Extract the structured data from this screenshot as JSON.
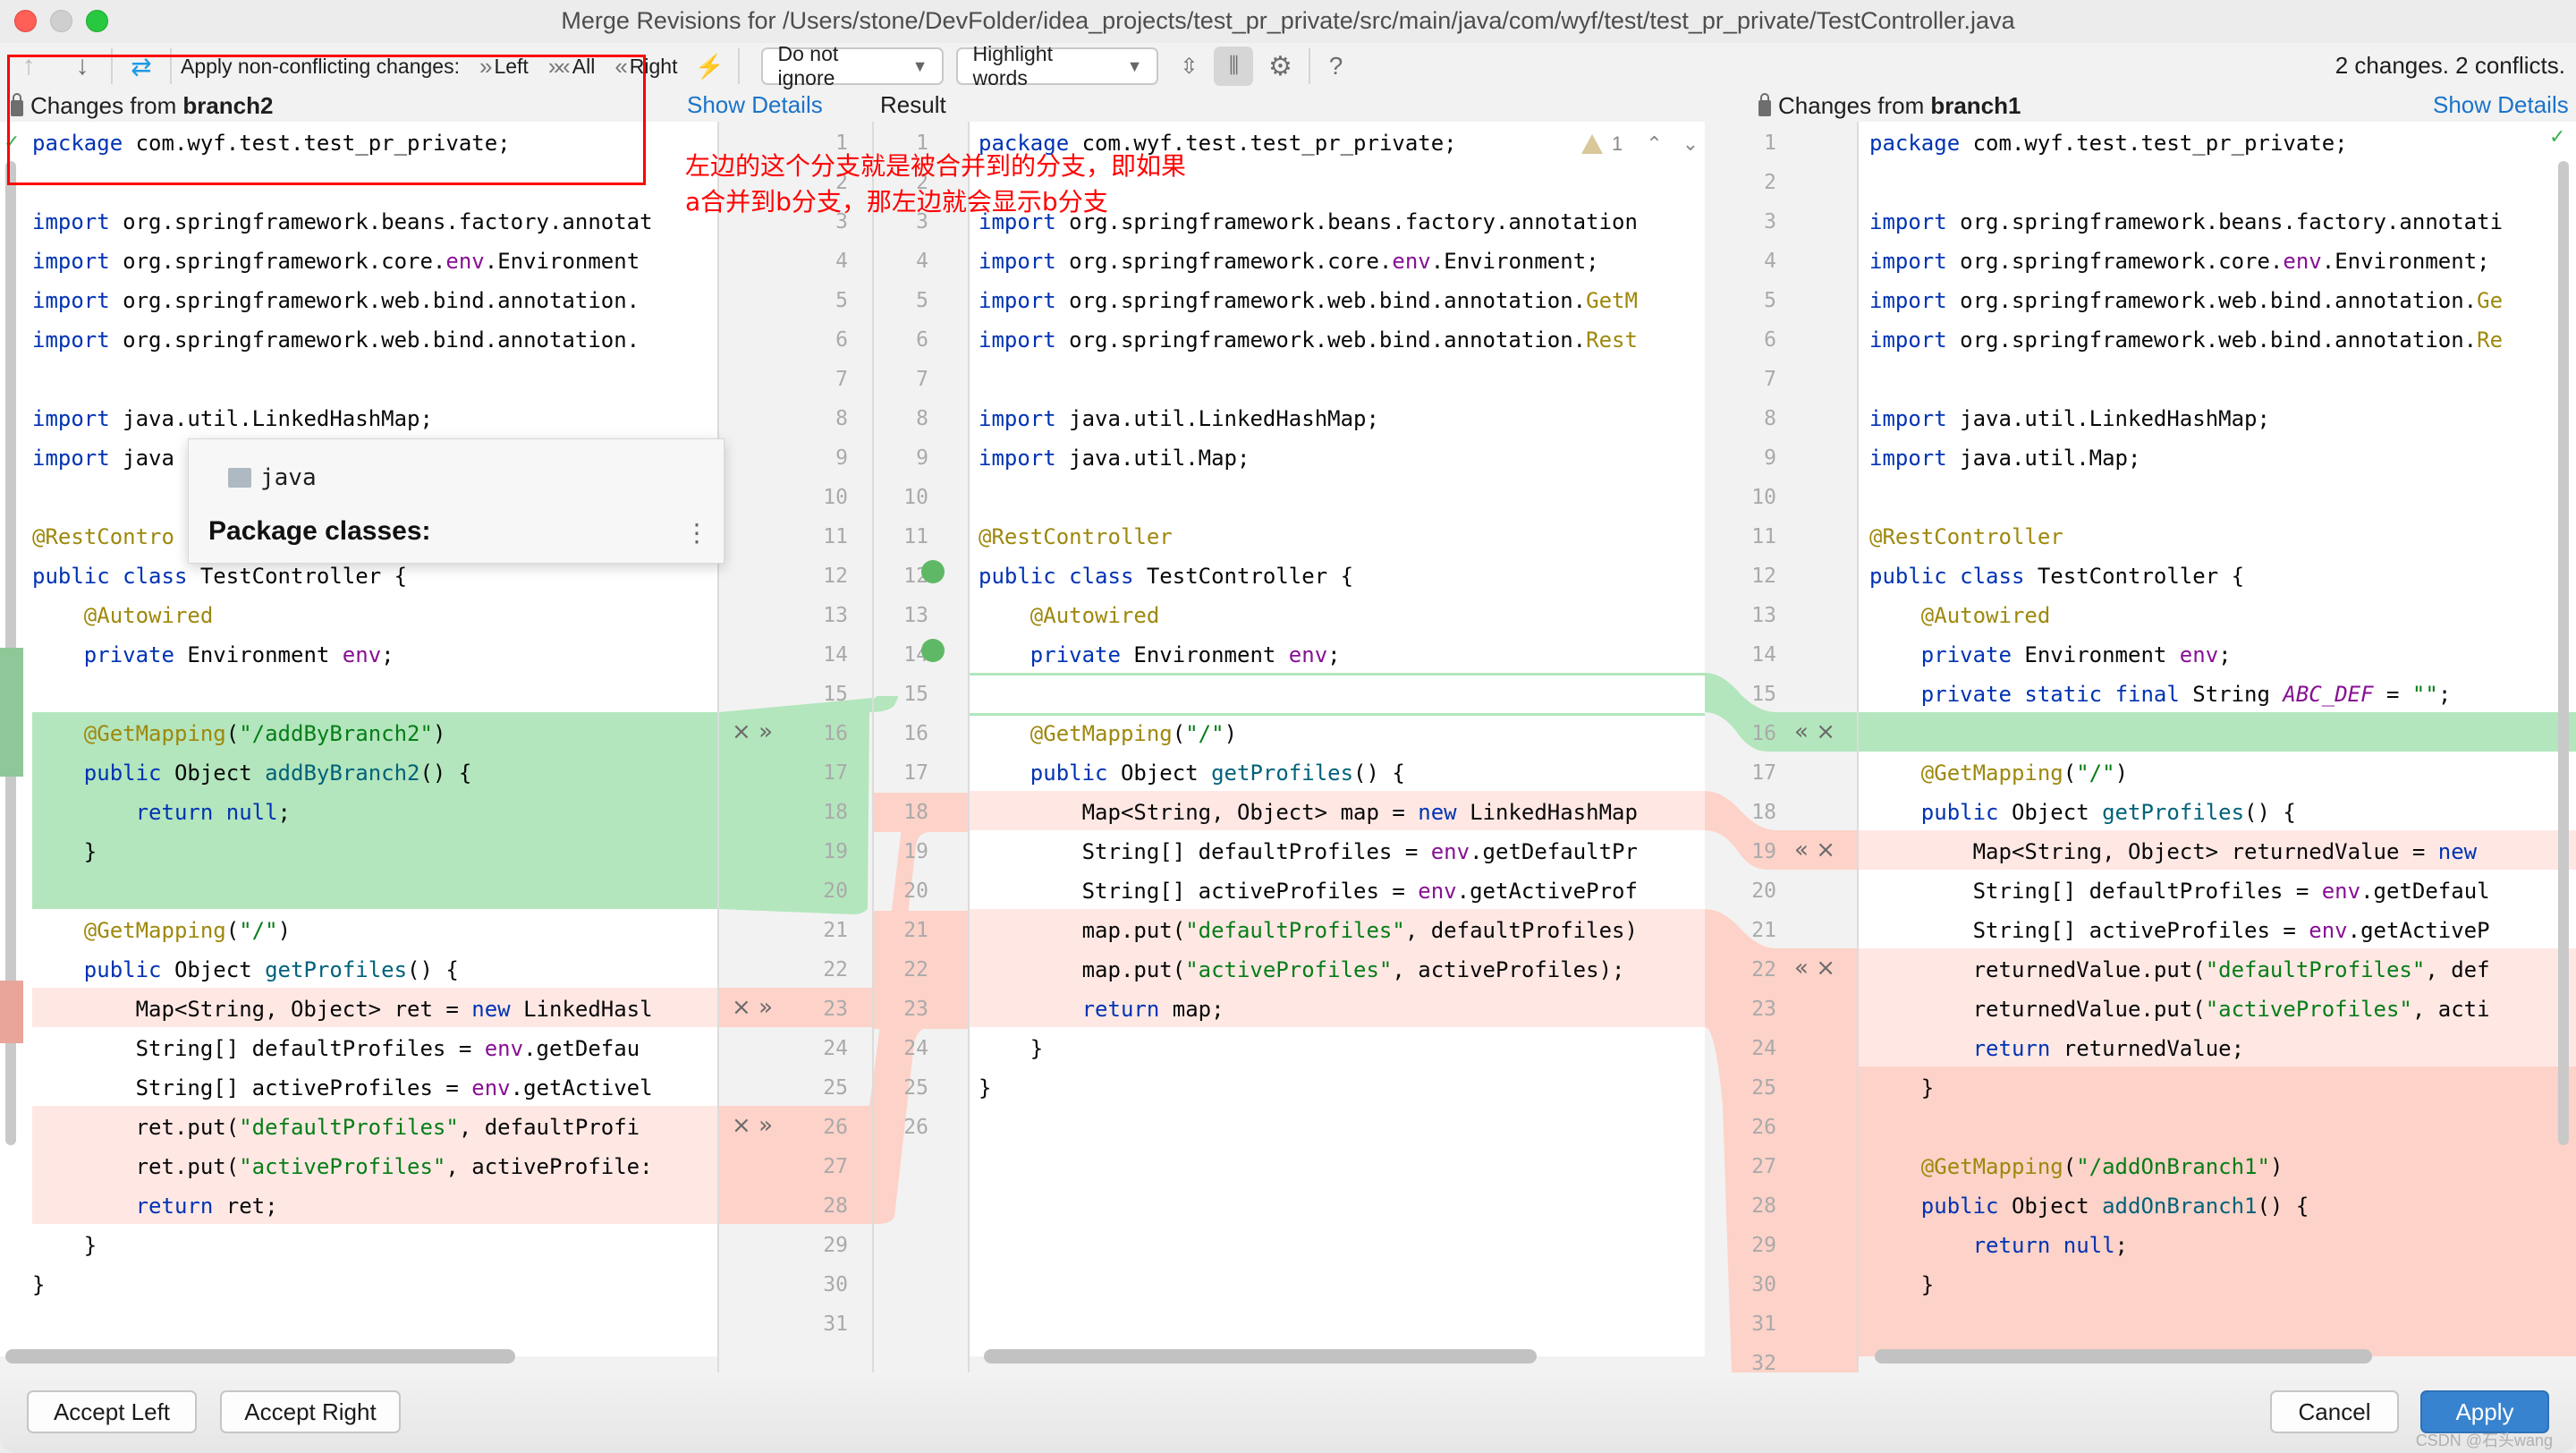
{
  "window": {
    "title": "Merge Revisions for /Users/stone/DevFolder/idea_projects/test_pr_private/src/main/java/com/wyf/test/test_pr_private/TestController.java"
  },
  "toolbar": {
    "prev_icon": "arrow-up-icon",
    "next_icon": "arrow-down-icon",
    "resolve_icon": "magic-resolve-icon",
    "apply_label": "Apply non-conflicting changes:",
    "left_label": "Left",
    "all_label": "All",
    "right_label": "Right",
    "ignore_dropdown": "Do not ignore",
    "highlight_dropdown": "Highlight words",
    "status": "2 changes. 2 conflicts."
  },
  "headers": {
    "left_prefix": "Changes from",
    "left_branch": "branch2",
    "left_show_details": "Show Details",
    "middle_title": "Result",
    "right_prefix": "Changes from",
    "right_branch": "branch1",
    "right_show_details": "Show Details"
  },
  "annotation": {
    "line1": "左边的这个分支就是被合并到的分支，即如果",
    "line2": "a合并到b分支，那左边就会显示b分支"
  },
  "popup": {
    "package": "java",
    "title": "Package classes:"
  },
  "warning": {
    "count": "1"
  },
  "left_pane": {
    "lines": [
      "package com.wyf.test.test_pr_private;",
      "",
      "import org.springframework.beans.factory.annotat",
      "import org.springframework.core.env.Environment",
      "import org.springframework.web.bind.annotation.",
      "import org.springframework.web.bind.annotation.",
      "",
      "import java.util.LinkedHashMap;",
      "import java",
      "",
      "@RestContro",
      "public class TestController {",
      "    @Autowired",
      "    private Environment env;",
      "",
      "    @GetMapping(\"/addByBranch2\")",
      "    public Object addByBranch2() {",
      "        return null;",
      "    }",
      "",
      "    @GetMapping(\"/\")",
      "    public Object getProfiles() {",
      "        Map<String, Object> ret = new LinkedHasl",
      "        String[] defaultProfiles = env.getDefau",
      "        String[] activeProfiles = env.getActivel",
      "        ret.put(\"defaultProfiles\", defaultProfi",
      "        ret.put(\"activeProfiles\", activeProfile:",
      "        return ret;",
      "    }",
      "}",
      ""
    ],
    "line_numbers": [
      "1",
      "2",
      "3",
      "4",
      "5",
      "6",
      "7",
      "8",
      "9",
      "10",
      "11",
      "12",
      "13",
      "14",
      "15",
      "16",
      "17",
      "18",
      "19",
      "20",
      "21",
      "22",
      "23",
      "24",
      "25",
      "26",
      "27",
      "28",
      "29",
      "30",
      "31"
    ]
  },
  "middle_pane": {
    "lines": [
      "package com.wyf.test.test_pr_private;",
      "",
      "import org.springframework.beans.factory.annotation",
      "import org.springframework.core.env.Environment;",
      "import org.springframework.web.bind.annotation.GetM",
      "import org.springframework.web.bind.annotation.Rest",
      "",
      "import java.util.LinkedHashMap;",
      "import java.util.Map;",
      "",
      "@RestController",
      "public class TestController {",
      "    @Autowired",
      "    private Environment env;",
      "",
      "    @GetMapping(\"/\")",
      "    public Object getProfiles() {",
      "        Map<String, Object> map = new LinkedHashMap",
      "        String[] defaultProfiles = env.getDefaultPr",
      "        String[] activeProfiles = env.getActiveProf",
      "        map.put(\"defaultProfiles\", defaultProfiles)",
      "        map.put(\"activeProfiles\", activeProfiles);",
      "        return map;",
      "    }",
      "}",
      ""
    ],
    "line_numbers": [
      "1",
      "2",
      "3",
      "4",
      "5",
      "6",
      "7",
      "8",
      "9",
      "10",
      "11",
      "12",
      "13",
      "14",
      "15",
      "16",
      "17",
      "18",
      "19",
      "20",
      "21",
      "22",
      "23",
      "24",
      "25",
      "26"
    ]
  },
  "right_pane": {
    "lines": [
      "package com.wyf.test.test_pr_private;",
      "",
      "import org.springframework.beans.factory.annotati",
      "import org.springframework.core.env.Environment;",
      "import org.springframework.web.bind.annotation.Ge",
      "import org.springframework.web.bind.annotation.Re",
      "",
      "import java.util.LinkedHashMap;",
      "import java.util.Map;",
      "",
      "@RestController",
      "public class TestController {",
      "    @Autowired",
      "    private Environment env;",
      "    private static final String ABC_DEF = \"\";",
      "",
      "    @GetMapping(\"/\")",
      "    public Object getProfiles() {",
      "        Map<String, Object> returnedValue = new",
      "        String[] defaultProfiles = env.getDefaul",
      "        String[] activeProfiles = env.getActiveP",
      "        returnedValue.put(\"defaultProfiles\", def",
      "        returnedValue.put(\"activeProfiles\", acti",
      "        return returnedValue;",
      "    }",
      "",
      "    @GetMapping(\"/addOnBranch1\")",
      "    public Object addOnBranch1() {",
      "        return null;",
      "    }",
      "",
      ""
    ],
    "line_numbers": [
      "1",
      "2",
      "3",
      "4",
      "5",
      "6",
      "7",
      "8",
      "9",
      "10",
      "11",
      "12",
      "13",
      "14",
      "15",
      "16",
      "17",
      "18",
      "19",
      "20",
      "21",
      "22",
      "23",
      "24",
      "25",
      "26",
      "27",
      "28",
      "29",
      "30",
      "31",
      "32"
    ]
  },
  "gutter_actions": {
    "accept_left": "»",
    "accept_right": "«",
    "ignore": "×"
  },
  "buttons": {
    "accept_left": "Accept Left",
    "accept_right": "Accept Right",
    "cancel": "Cancel",
    "apply": "Apply"
  },
  "watermark": "CSDN @石头wang",
  "colors": {
    "added": "#b3e6bd",
    "conflict": "#fdd2c8",
    "conflict_light": "#ffe8e4",
    "link": "#1b73c9",
    "primary_button": "#3883d0",
    "annotation": "#ff0000"
  }
}
